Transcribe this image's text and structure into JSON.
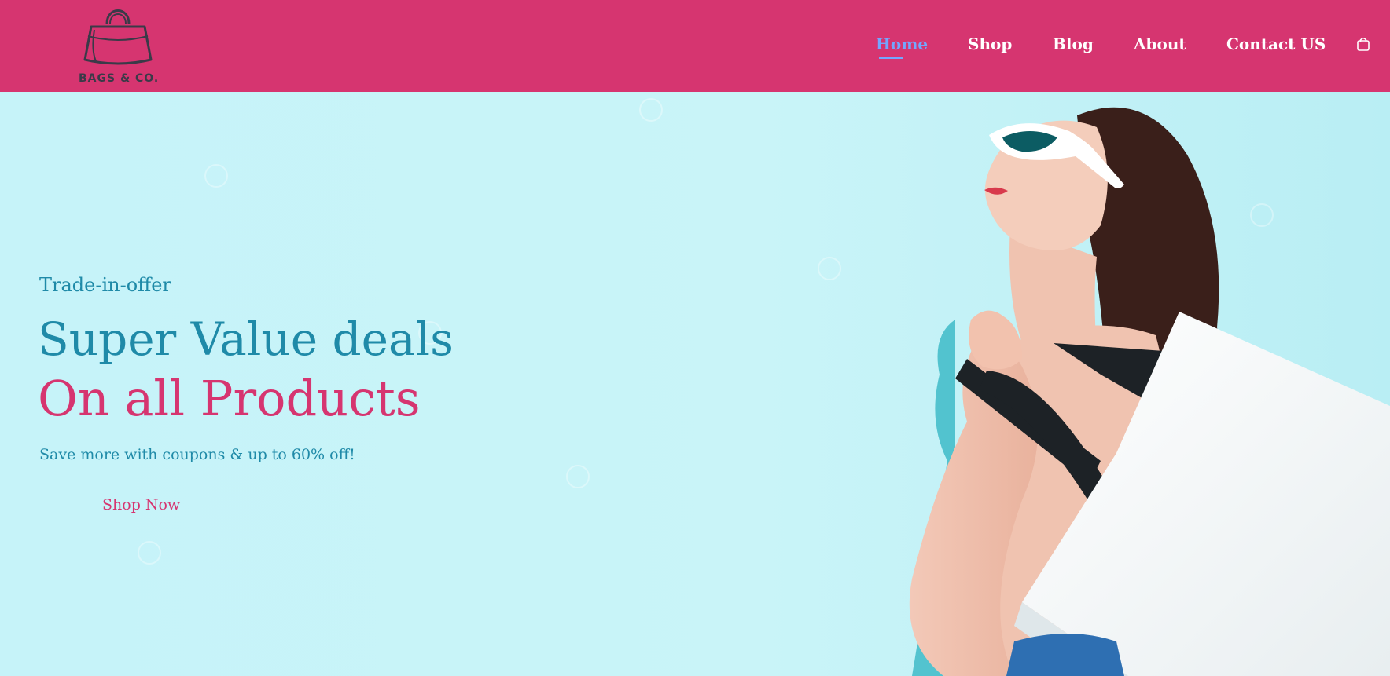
{
  "brand": {
    "name": "BAGS & CO."
  },
  "nav": {
    "items": [
      {
        "label": "Home",
        "active": true
      },
      {
        "label": "Shop",
        "active": false
      },
      {
        "label": "Blog",
        "active": false
      },
      {
        "label": "About",
        "active": false
      },
      {
        "label": "Contact US",
        "active": false
      }
    ]
  },
  "icons": {
    "cart": "shopping-bag-icon",
    "logo": "handbag-icon"
  },
  "hero": {
    "tag": "Trade-in-offer",
    "headline_1": "Super Value deals",
    "headline_2": "On all Products",
    "description": "Save more with coupons & up to 60% off!",
    "cta_label": "Shop Now"
  },
  "colors": {
    "header_bg": "#d63570",
    "hero_bg": "#c9f3f8",
    "accent_blue": "#1f8aa8",
    "accent_pink": "#d63570",
    "nav_active": "#73a6ff"
  }
}
